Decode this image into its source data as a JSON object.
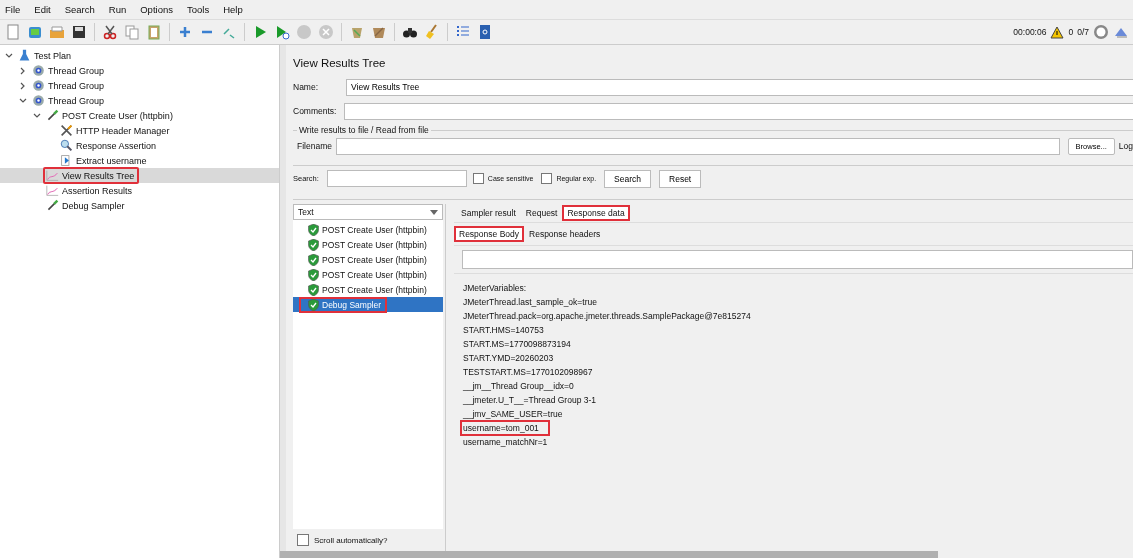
{
  "menu": [
    "File",
    "Edit",
    "Search",
    "Run",
    "Options",
    "Tools",
    "Help"
  ],
  "status": {
    "timer": "00:00:06",
    "warnings": "0",
    "threads": "0/7"
  },
  "tree": [
    {
      "label": "Test Plan",
      "kind": "plan",
      "expanded": true,
      "selected": false,
      "highlighted": false,
      "children": [
        {
          "label": "Thread Group",
          "kind": "threads",
          "expanded": false,
          "selected": false,
          "highlighted": false
        },
        {
          "label": "Thread Group",
          "kind": "threads",
          "expanded": false,
          "selected": false,
          "highlighted": false
        },
        {
          "label": "Thread Group",
          "kind": "threads",
          "expanded": true,
          "selected": false,
          "highlighted": false,
          "children": [
            {
              "label": "POST Create User (httpbin)",
              "kind": "sampler",
              "expanded": true,
              "selected": false,
              "highlighted": false,
              "children": [
                {
                  "label": "HTTP Header Manager",
                  "kind": "config",
                  "selected": false,
                  "highlighted": false
                },
                {
                  "label": "Response Assertion",
                  "kind": "assertion",
                  "selected": false,
                  "highlighted": false
                },
                {
                  "label": "Extract username",
                  "kind": "extractor",
                  "selected": false,
                  "highlighted": false
                }
              ]
            },
            {
              "label": "View Results Tree",
              "kind": "listener",
              "selected": true,
              "highlighted": true
            },
            {
              "label": "Assertion Results",
              "kind": "listener",
              "selected": false,
              "highlighted": false
            },
            {
              "label": "Debug Sampler",
              "kind": "sampler",
              "selected": false,
              "highlighted": false
            }
          ]
        }
      ]
    }
  ],
  "panel": {
    "title": "View Results Tree",
    "name_label": "Name:",
    "name_value": "View Results Tree",
    "comments_label": "Comments:",
    "file_group": "Write results to file / Read from file",
    "filename_label": "Filename",
    "browse_button": "Browse...",
    "log_label": "Log",
    "search_label": "Search:",
    "case_sensitive": {
      "label": "Case sensitive",
      "checked": false
    },
    "regex": {
      "label": "Regular exp.",
      "checked": false
    },
    "search_button": "Search",
    "reset_button": "Reset"
  },
  "results": {
    "renderer": "Text",
    "samples": [
      {
        "label": "POST Create User (httpbin)",
        "selected": false,
        "highlighted": false
      },
      {
        "label": "POST Create User (httpbin)",
        "selected": false,
        "highlighted": false
      },
      {
        "label": "POST Create User (httpbin)",
        "selected": false,
        "highlighted": false
      },
      {
        "label": "POST Create User (httpbin)",
        "selected": false,
        "highlighted": false
      },
      {
        "label": "POST Create User (httpbin)",
        "selected": false,
        "highlighted": false
      },
      {
        "label": "Debug Sampler",
        "selected": true,
        "highlighted": true
      }
    ],
    "scroll_auto": {
      "label": "Scroll automatically?",
      "checked": false
    }
  },
  "tabs": [
    {
      "label": "Sampler result",
      "selected": false,
      "highlighted": false
    },
    {
      "label": "Request",
      "selected": false,
      "highlighted": false
    },
    {
      "label": "Response data",
      "selected": true,
      "highlighted": true
    }
  ],
  "subtabs": [
    {
      "label": "Response Body",
      "selected": true,
      "highlighted": true
    },
    {
      "label": "Response headers",
      "selected": false,
      "highlighted": false
    }
  ],
  "response_lines": [
    {
      "text": "JMeterVariables:",
      "highlighted": false
    },
    {
      "text": "JMeterThread.last_sample_ok=true",
      "highlighted": false
    },
    {
      "text": "JMeterThread.pack=org.apache.jmeter.threads.SamplePackage@7e815274",
      "highlighted": false
    },
    {
      "text": "START.HMS=140753",
      "highlighted": false
    },
    {
      "text": "START.MS=1770098873194",
      "highlighted": false
    },
    {
      "text": "START.YMD=20260203",
      "highlighted": false
    },
    {
      "text": "TESTSTART.MS=1770102098967",
      "highlighted": false
    },
    {
      "text": "__jm__Thread Group__idx=0",
      "highlighted": false
    },
    {
      "text": "__jmeter.U_T__=Thread Group 3-1",
      "highlighted": false
    },
    {
      "text": "__jmv_SAME_USER=true",
      "highlighted": false
    },
    {
      "text": "username=tom_001",
      "highlighted": true
    },
    {
      "text": "username_matchNr=1",
      "highlighted": false
    }
  ]
}
